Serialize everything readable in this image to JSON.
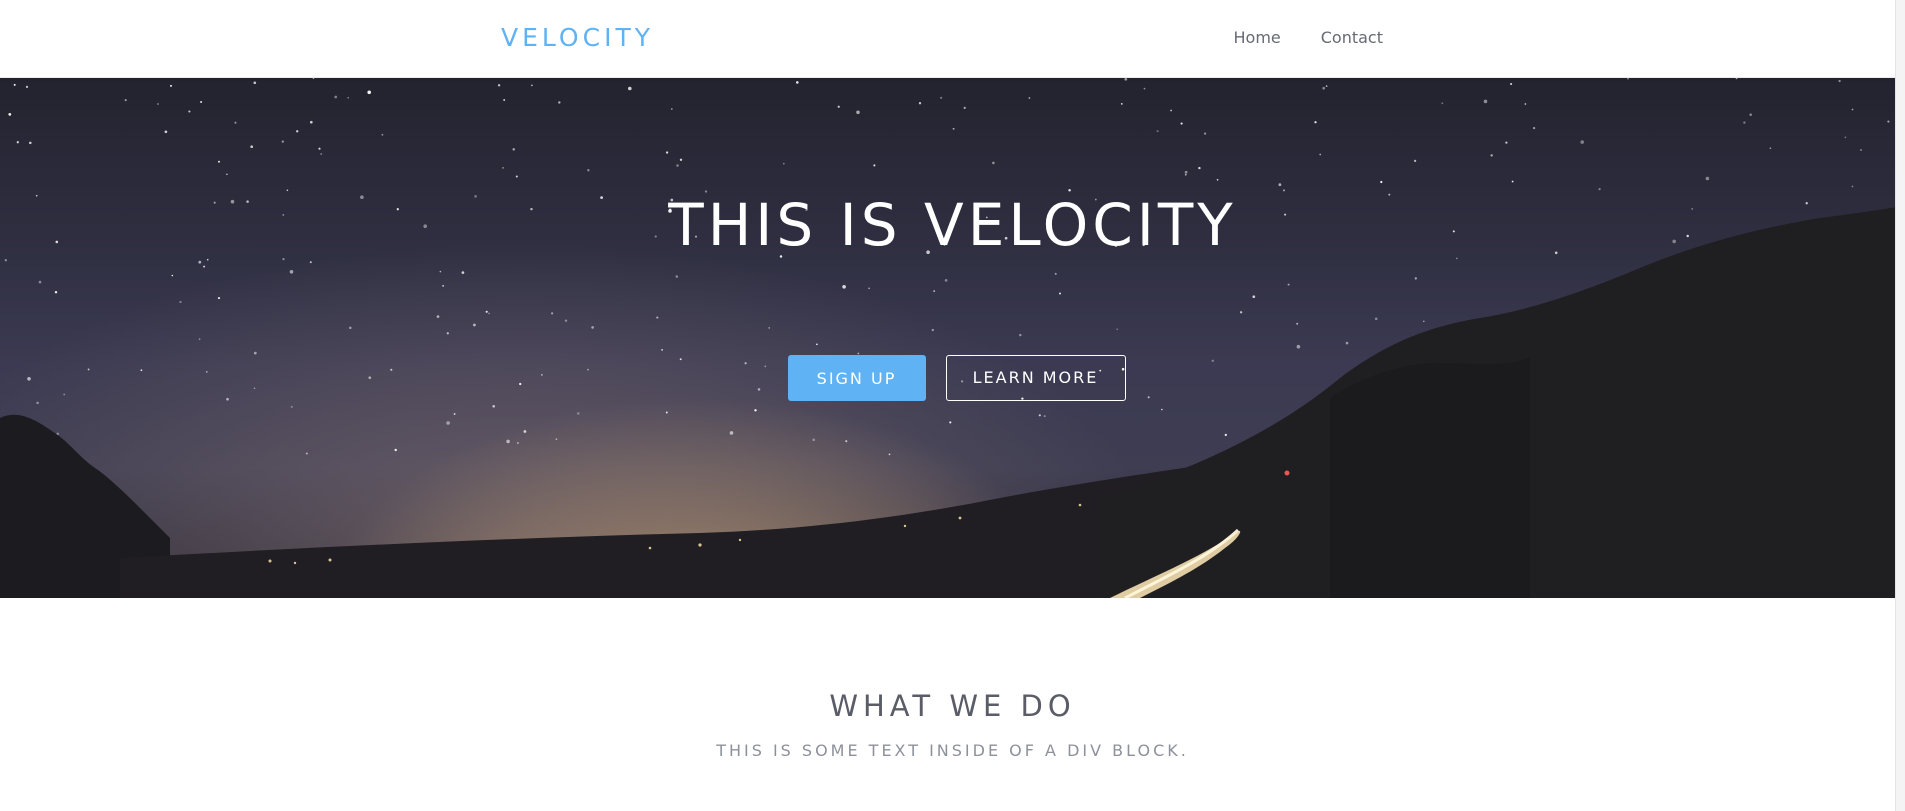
{
  "navbar": {
    "brand": "VELOCITY",
    "links": [
      {
        "label": "Home"
      },
      {
        "label": "Contact"
      }
    ]
  },
  "hero": {
    "title": "THIS IS VELOCITY",
    "primary_button": "SIGN UP",
    "secondary_button": "LEARN MORE"
  },
  "section": {
    "title": "WHAT WE DO",
    "subtitle": "THIS IS SOME TEXT INSIDE OF A DIV BLOCK."
  },
  "colors": {
    "accent": "#5fb3f5",
    "heading": "#5a5d68",
    "muted": "#8d919c",
    "nav_text": "#666a73"
  }
}
